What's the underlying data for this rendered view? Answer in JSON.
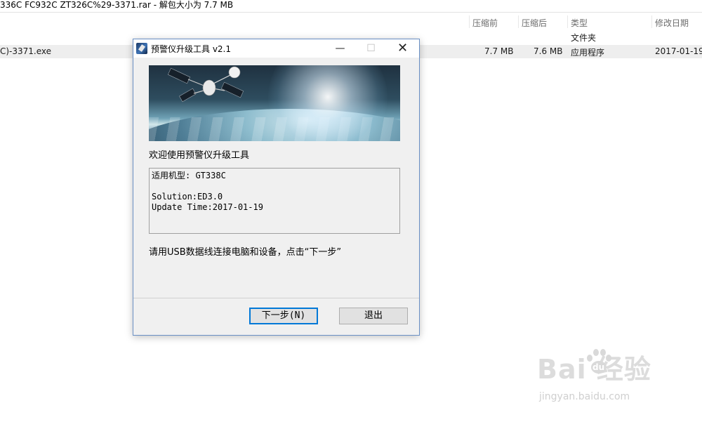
{
  "archive": {
    "title": "336C FC932C ZT326C%29-3371.rar - 解包大小为 7.7 MB",
    "columns": [
      "压缩前",
      "压缩后",
      "类型",
      "修改日期"
    ],
    "rows": [
      {
        "name": "",
        "packed_before": "",
        "packed_after": "",
        "type": "文件夹",
        "date": ""
      },
      {
        "name": "C)-3371.exe",
        "packed_before": "7.7 MB",
        "packed_after": "7.6 MB",
        "type": "应用程序",
        "date": "2017-01-19"
      }
    ]
  },
  "dialog": {
    "title": "预警仪升级工具 v2.1",
    "controls": {
      "minimize": "—",
      "maximize": "☐",
      "close": "✕"
    },
    "welcome": "欢迎使用预警仪升级工具",
    "info": {
      "model": "适用机型: GT338C",
      "solution": "Solution:ED3.0",
      "update_time": "Update Time:2017-01-19"
    },
    "instruction": "请用USB数据线连接电脑和设备，点击“下一步”",
    "next_button": "下一步(N)",
    "exit_button": "退出"
  },
  "watermark": {
    "brand": "Bai  经验",
    "du": "du",
    "url": "jingyan.baidu.com"
  },
  "colors": {
    "dialog_border": "#6a90c5",
    "default_button_border": "#0078d7",
    "dialog_bg": "#f0f0f0"
  }
}
